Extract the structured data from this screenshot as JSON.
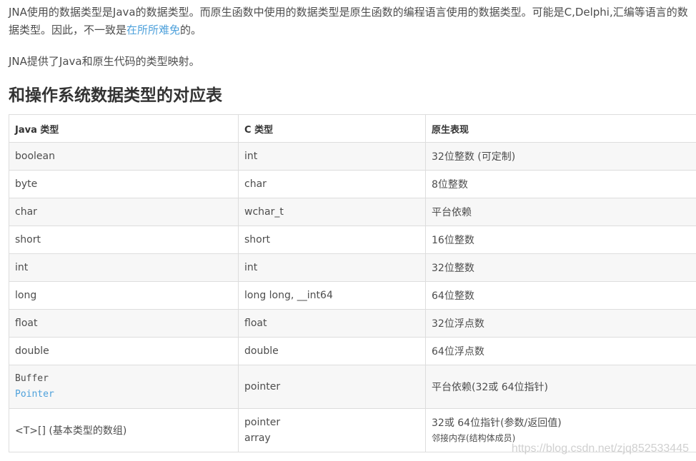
{
  "intro": {
    "line1_part1": "JNA使用的数据类型是Java的数据类型。而原生函数中使用的数据类型是原生函数的编程语言使用的数据类型。可能是C,Delphi,汇编等语言的数据类型。因此，不一致是",
    "line1_link": "在所所难免",
    "line1_end": "的。",
    "line2": "JNA提供了Java和原生代码的类型映射。"
  },
  "section_title": "和操作系统数据类型的对应表",
  "table": {
    "headers": [
      "Java 类型",
      "C 类型",
      "原生表现"
    ],
    "rows": [
      [
        "boolean",
        "int",
        "32位整数 (可定制)"
      ],
      [
        "byte",
        "char",
        "8位整数"
      ],
      [
        "char",
        "wchar_t",
        "平台依赖"
      ],
      [
        "short",
        "short",
        "16位整数"
      ],
      [
        "int",
        "int",
        "32位整数"
      ],
      [
        "long",
        "long long, __int64",
        "64位整数"
      ],
      [
        "float",
        "float",
        "32位浮点数"
      ],
      [
        "double",
        "double",
        "64位浮点数"
      ]
    ],
    "buffer_row": {
      "java_line1": "Buffer",
      "java_line2": "Pointer",
      "c": "pointer",
      "native": "平台依赖(32或 64位指针)"
    },
    "array_row": {
      "java": "<T>[] (基本类型的数组)",
      "c_line1": "pointer",
      "c_line2": "array",
      "native_line1": "32或 64位指针(参数/返回值)",
      "native_line2": "邻接内存(结构体成员)"
    }
  },
  "watermark": "https://blog.csdn.net/zjq852533445",
  "colors": {
    "link": "#4ea1db",
    "border": "#dddddd",
    "stripe": "#f7f7f7"
  }
}
